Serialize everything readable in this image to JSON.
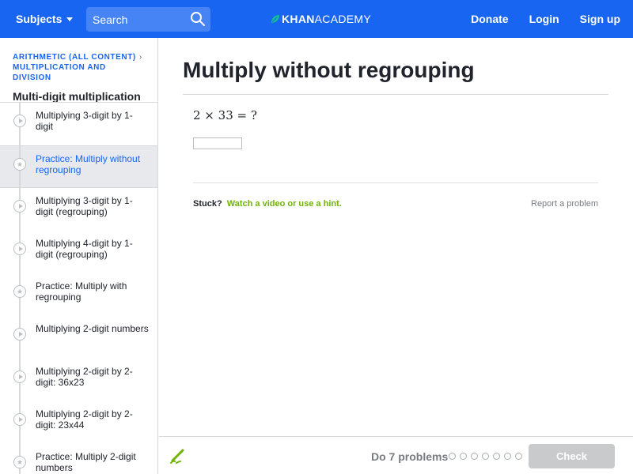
{
  "header": {
    "subjects_label": "Subjects",
    "search_placeholder": "Search",
    "logo_khan": "KHAN",
    "logo_academy": "ACADEMY",
    "donate_label": "Donate",
    "login_label": "Login",
    "signup_label": "Sign up",
    "brand_color": "#1865f2"
  },
  "sidebar": {
    "crumb_1": "ARITHMETIC (ALL CONTENT)",
    "crumb_2": "MULTIPLICATION AND DIVISION",
    "unit_title": "Multi-digit multiplication",
    "items": [
      {
        "label": "Multiplying 3-digit by 1-digit",
        "icon": "play-icon",
        "active": false
      },
      {
        "label": "Practice: Multiply without regrouping",
        "icon": "star-icon",
        "active": true
      },
      {
        "label": "Multiplying 3-digit by 1-digit (regrouping)",
        "icon": "play-icon",
        "active": false
      },
      {
        "label": "Multiplying 4-digit by 1-digit (regrouping)",
        "icon": "play-icon",
        "active": false
      },
      {
        "label": "Practice: Multiply with regrouping",
        "icon": "star-icon",
        "active": false
      },
      {
        "label": "Multiplying 2-digit numbers",
        "icon": "play-icon",
        "active": false
      },
      {
        "label": "Multiplying 2-digit by 2-digit: 36x23",
        "icon": "play-icon",
        "active": false
      },
      {
        "label": "Multiplying 2-digit by 2-digit: 23x44",
        "icon": "play-icon",
        "active": false
      },
      {
        "label": "Practice: Multiply 2-digit numbers",
        "icon": "star-icon",
        "active": false
      }
    ]
  },
  "main": {
    "title": "Multiply without regrouping",
    "question": "2 × 33 = ?",
    "answer_value": "",
    "stuck_label": "Stuck?",
    "hint_link": "Watch a video or use a hint.",
    "report_link": "Report a problem"
  },
  "footer": {
    "do_label": "Do 7 problems",
    "progress_total": 7,
    "progress_done": 0,
    "check_label": "Check"
  }
}
